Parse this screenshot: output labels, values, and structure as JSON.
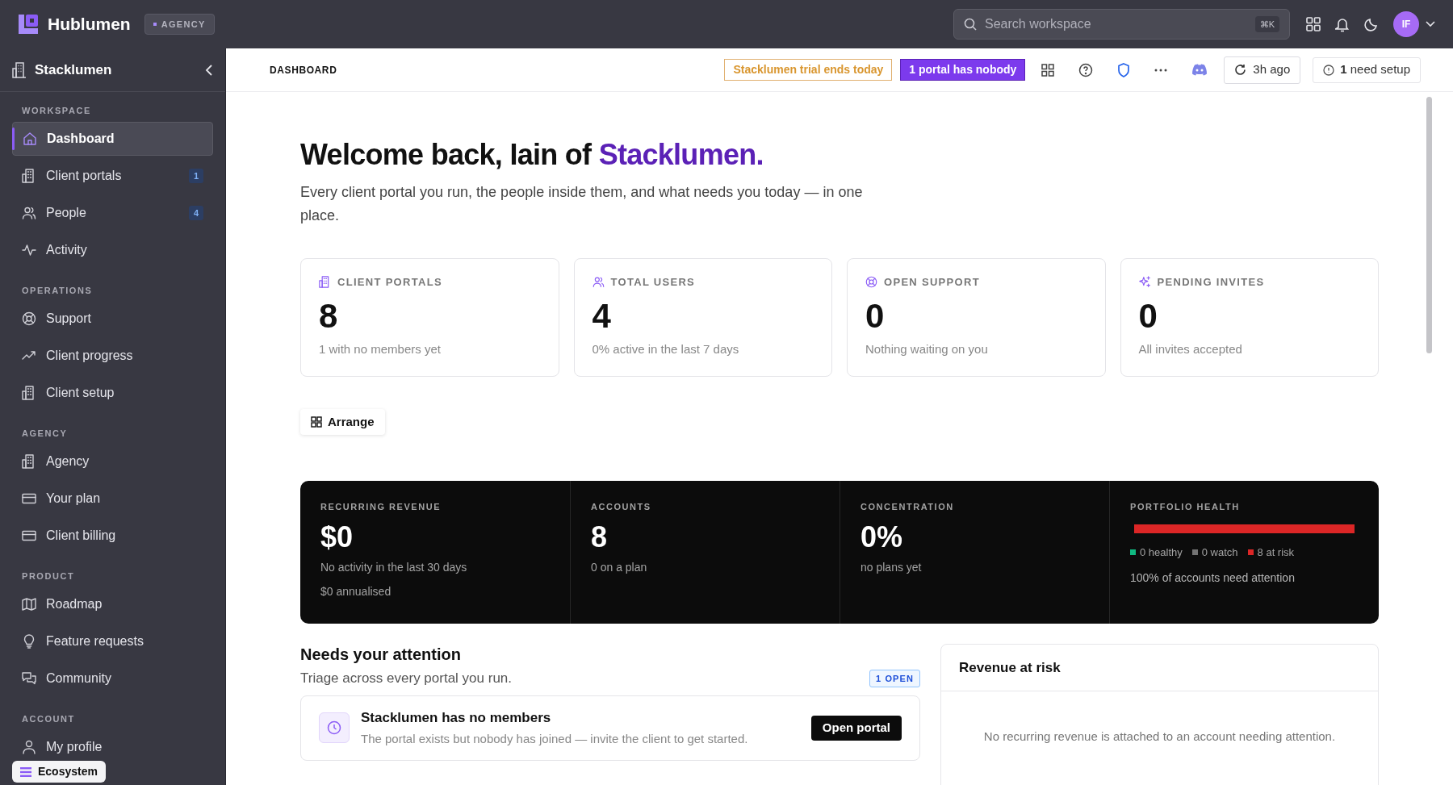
{
  "topbar": {
    "brand": "Hublumen",
    "badge": "AGENCY",
    "search": {
      "placeholder": "Search workspace",
      "shortcut": "⌘K"
    },
    "avatar": "IF"
  },
  "sidebar": {
    "workspace": "Stacklumen",
    "sections": [
      {
        "title": "WORKSPACE",
        "items": [
          {
            "label": "Dashboard",
            "selected": true
          },
          {
            "label": "Client portals",
            "selected": false,
            "count": "1"
          },
          {
            "label": "People",
            "selected": false,
            "count": "4"
          },
          {
            "label": "Activity",
            "selected": false
          }
        ]
      },
      {
        "title": "OPERATIONS",
        "items": [
          {
            "label": "Support",
            "selected": false
          },
          {
            "label": "Client progress",
            "selected": false
          },
          {
            "label": "Client setup",
            "selected": false
          }
        ]
      },
      {
        "title": "AGENCY",
        "items": [
          {
            "label": "Agency",
            "selected": false
          },
          {
            "label": "Your plan",
            "selected": false
          },
          {
            "label": "Client billing",
            "selected": false
          }
        ]
      },
      {
        "title": "PRODUCT",
        "items": [
          {
            "label": "Roadmap",
            "selected": false
          },
          {
            "label": "Feature requests",
            "selected": false
          },
          {
            "label": "Community",
            "selected": false
          }
        ]
      },
      {
        "title": "ACCOUNT",
        "items": [
          {
            "label": "My profile",
            "selected": false
          }
        ]
      }
    ],
    "ecosystem": "Ecosystem"
  },
  "header": {
    "title": "DASHBOARD",
    "trial": "Stacklumen trial ends today",
    "alert": "1 portal has nobody",
    "sync": "3h ago",
    "setup": "**1** need setup"
  },
  "welcome": {
    "greeting": "Welcome back, Iain of ",
    "name": "Stacklumen.",
    "subtitle": "Every client portal you run, the people inside them, and what needs you today — in one place."
  },
  "stats": [
    {
      "label": "CLIENT PORTALS",
      "value": "8",
      "note": "1 with no members yet"
    },
    {
      "label": "TOTAL USERS",
      "value": "4",
      "note": "0% active in the last 7 days"
    },
    {
      "label": "OPEN SUPPORT",
      "value": "0",
      "note": "Nothing waiting on you"
    },
    {
      "label": "PENDING INVITES",
      "value": "0",
      "note": "All invites accepted"
    }
  ],
  "arrange": "Arrange",
  "metrics": [
    {
      "kind": "value",
      "label": "RECURRING REVENUE",
      "value": "$0",
      "notes": [
        "No activity in the last 30 days",
        "$0 annualised"
      ]
    },
    {
      "kind": "value",
      "label": "ACCOUNTS",
      "value": "8",
      "notes": [
        "0 on a plan"
      ]
    },
    {
      "kind": "value",
      "label": "CONCENTRATION",
      "value": "0%",
      "notes": [
        "no plans yet"
      ]
    },
    {
      "kind": "health",
      "label": "PORTFOLIO HEALTH",
      "segments": [
        {
          "label": "0 healthy",
          "color": "#10b981",
          "level": 0
        },
        {
          "label": "0 watch",
          "color": "#737373",
          "level": 0
        },
        {
          "label": "8 at risk",
          "color": "#dc2626",
          "level": 1
        }
      ],
      "notes": [
        "100% of accounts need attention"
      ]
    }
  ],
  "attention": {
    "title": "Needs your attention",
    "subtitle": "Triage across every portal you run.",
    "badge": "1 OPEN",
    "items": [
      {
        "title": "Stacklumen has no members",
        "text": "The portal exists but nobody has joined — invite the client to get started.",
        "action": "Open portal"
      }
    ]
  },
  "revenue_at_risk": {
    "title": "Revenue at risk",
    "empty": "No recurring revenue is attached to an account needing attention."
  }
}
